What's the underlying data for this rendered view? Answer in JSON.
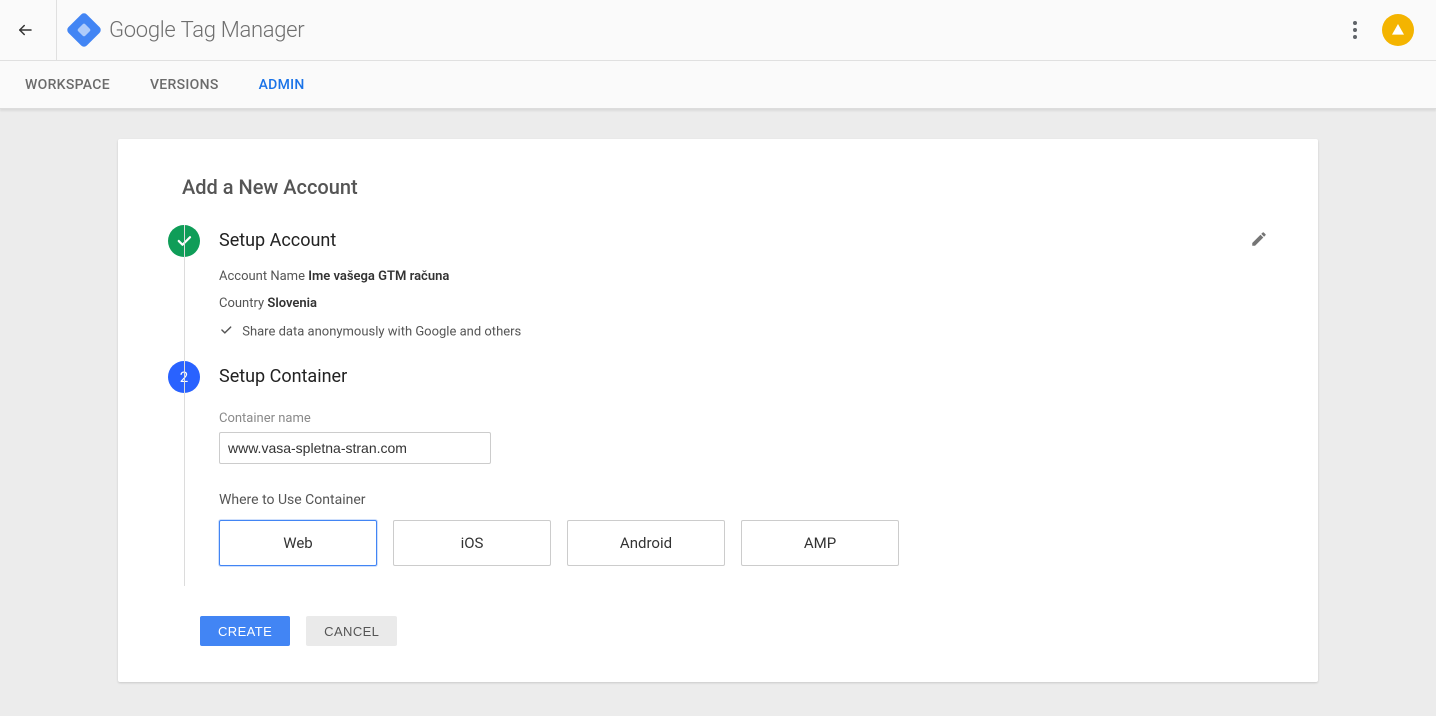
{
  "header": {
    "product_bold": "Google",
    "product_light": "Tag Manager"
  },
  "tabs": {
    "workspace": "WORKSPACE",
    "versions": "VERSIONS",
    "admin": "ADMIN"
  },
  "card": {
    "title": "Add a New Account"
  },
  "step1": {
    "title": "Setup Account",
    "account_name_label": "Account Name",
    "account_name_value": "Ime vašega GTM računa",
    "country_label": "Country",
    "country_value": "Slovenia",
    "share_text": "Share data anonymously with Google and others"
  },
  "step2": {
    "number": "2",
    "title": "Setup Container",
    "container_name_label": "Container name",
    "container_name_value": "www.vasa-spletna-stran.com",
    "where_label": "Where to Use Container",
    "options": {
      "web": "Web",
      "ios": "iOS",
      "android": "Android",
      "amp": "AMP"
    }
  },
  "buttons": {
    "create": "CREATE",
    "cancel": "CANCEL"
  }
}
